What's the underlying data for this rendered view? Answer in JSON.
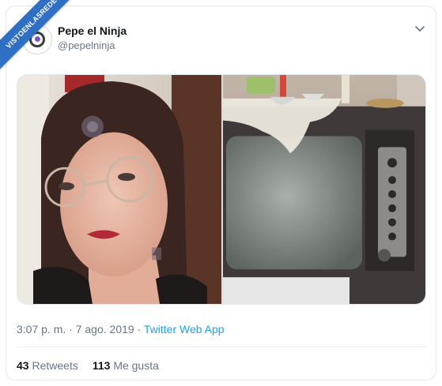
{
  "watermark": {
    "text": "VISTOENLASREDES"
  },
  "tweet": {
    "display_name": "Pepe el Ninja",
    "handle": "@pepelninja",
    "time": "3:07 p. m.",
    "separator": "·",
    "date": "7 ago. 2019",
    "app": "Twitter Web App",
    "retweets_count": "43",
    "retweets_label": "Retweets",
    "likes_count": "113",
    "likes_label": "Me gusta"
  },
  "icons": {
    "menu": "chevron-down-icon",
    "avatar": "avatar"
  },
  "colors": {
    "link": "#1da1f2",
    "secondary_text": "#657786",
    "primary_text": "#14171a",
    "border": "#e1e8ed",
    "watermark_bg": "#2f6fc4"
  }
}
